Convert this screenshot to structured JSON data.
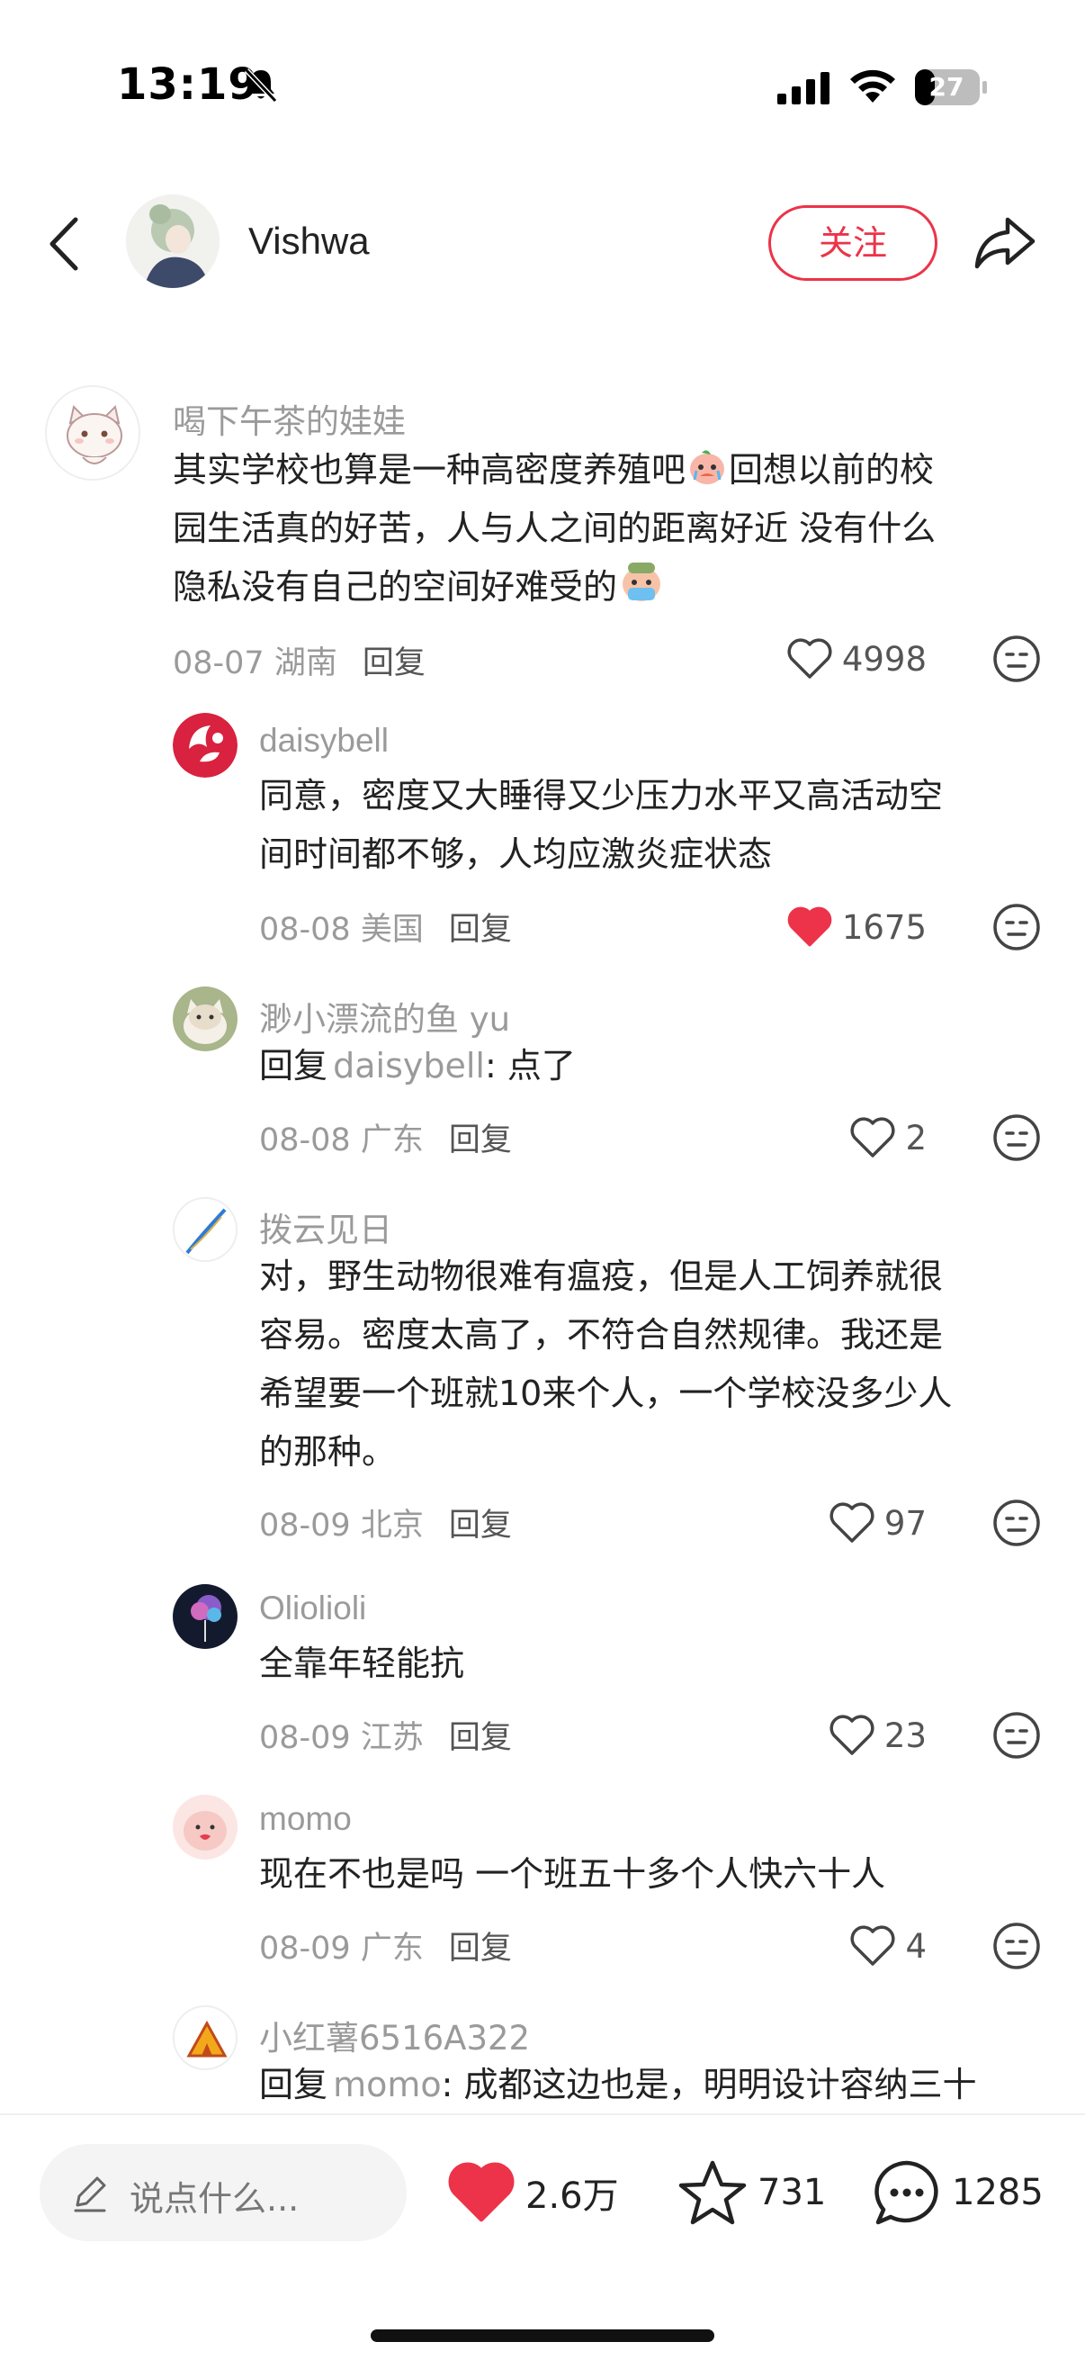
{
  "status_bar": {
    "time": "13:19",
    "battery": "27"
  },
  "header": {
    "author": "Vishwa",
    "follow_label": "关注"
  },
  "comments": [
    {
      "nickname": "喝下午茶的娃娃",
      "text": "其实学校也算是一种高密度养殖吧😭回想以前的校园生活真的好苦，人与人之间的距离好近 没有什么隐私没有自己的空间好难受的😭",
      "text_line1": "其实学校也算是一种高密度养殖吧",
      "text_line1_tail": "回想以前的校",
      "text_line2": "园生活真的好苦，人与人之间的距离好近 没有什么",
      "text_line3": "隐私没有自己的空间好难受的",
      "date_location": "08-07 湖南",
      "reply_label": "回复",
      "likes": "4998",
      "liked": false
    },
    {
      "nickname": "daisybell",
      "text_line1": "同意，密度又大睡得又少压力水平又高活动空",
      "text_line2": "间时间都不够，人均应激炎症状态",
      "date_location": "08-08 美国",
      "reply_label": "回复",
      "likes": "1675",
      "liked": true
    },
    {
      "nickname": "渺小漂流的鱼 yu",
      "reply_prefix": "回复",
      "reply_to": "daisybell",
      "text": ": 点了",
      "date_location": "08-08 广东",
      "reply_label": "回复",
      "likes": "2",
      "liked": false
    },
    {
      "nickname": "拨云见日",
      "text_line1": "对，野生动物很难有瘟疫，但是人工饲养就很",
      "text_line2": "容易。密度太高了，不符合自然规律。我还是",
      "text_line3": "希望要一个班就10来个人，一个学校没多少人",
      "text_line4": "的那种。",
      "date_location": "08-09 北京",
      "reply_label": "回复",
      "likes": "97",
      "liked": false
    },
    {
      "nickname": "Oliolioli",
      "text": "全靠年轻能抗",
      "date_location": "08-09 江苏",
      "reply_label": "回复",
      "likes": "23",
      "liked": false
    },
    {
      "nickname": "momo",
      "text": "现在不也是吗 一个班五十多个人快六十人",
      "date_location": "08-09 广东",
      "reply_label": "回复",
      "likes": "4",
      "liked": false
    },
    {
      "nickname": "小红薯6516A322",
      "reply_prefix": "回复",
      "reply_to": "momo",
      "text": ": 成都这边也是，明明设计容纳三十"
    }
  ],
  "bottom_bar": {
    "input_placeholder": "说点什么...",
    "likes": "2.6万",
    "stars": "731",
    "comments": "1285"
  },
  "colors": {
    "accent": "#ec3349",
    "muted": "#9a9a9a"
  }
}
